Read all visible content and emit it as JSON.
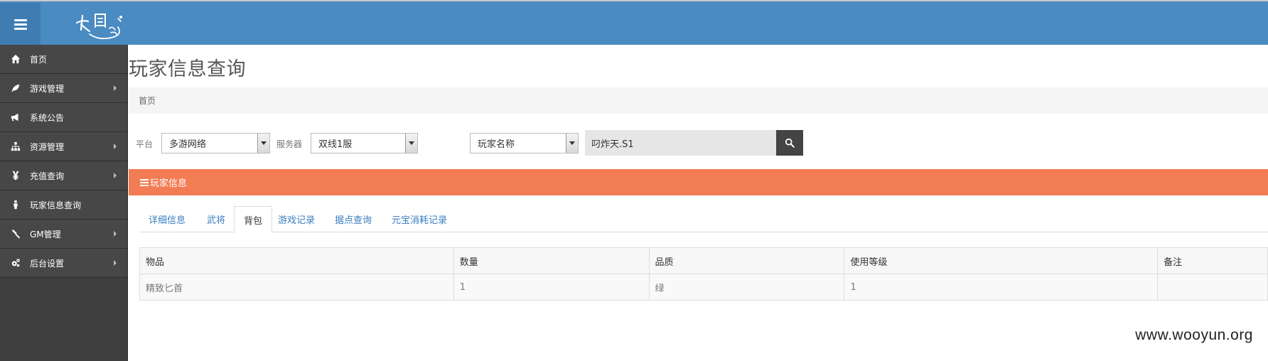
{
  "header": {
    "menu_toggle": "menu",
    "logo_icon": "calligraphy-logo-icon"
  },
  "sidebar": {
    "items": [
      {
        "label": "首页",
        "icon": "home-icon",
        "has_submenu": false
      },
      {
        "label": "游戏管理",
        "icon": "leaf-icon",
        "has_submenu": true
      },
      {
        "label": "系统公告",
        "icon": "bullhorn-icon",
        "has_submenu": false
      },
      {
        "label": "资源管理",
        "icon": "sitemap-icon",
        "has_submenu": true
      },
      {
        "label": "充值查询",
        "icon": "yen-icon",
        "has_submenu": true
      },
      {
        "label": "玩家信息查询",
        "icon": "user-icon",
        "has_submenu": false
      },
      {
        "label": "GM管理",
        "icon": "gavel-icon",
        "has_submenu": true
      },
      {
        "label": "后台设置",
        "icon": "gears-icon",
        "has_submenu": true
      }
    ]
  },
  "page": {
    "title": "玩家信息查询",
    "breadcrumb": "首页"
  },
  "filters": {
    "platform_label": "平台",
    "platform_value": "多游网络",
    "server_label": "服务器",
    "server_value": "双线1服",
    "query_type_value": "玩家名称",
    "search_value": "叼炸天.S1"
  },
  "panel": {
    "title": "玩家信息",
    "tabs": [
      {
        "label": "详细信息",
        "active": false
      },
      {
        "label": "武将",
        "active": false
      },
      {
        "label": "背包",
        "active": true
      },
      {
        "label": "游戏记录",
        "active": false
      },
      {
        "label": "据点查询",
        "active": false
      },
      {
        "label": "元宝消耗记录",
        "active": false
      }
    ]
  },
  "table": {
    "columns": [
      "物品",
      "数量",
      "品质",
      "使用等级",
      "备注"
    ],
    "rows": [
      [
        "精致匕首",
        "1",
        "绿",
        "1",
        ""
      ]
    ]
  },
  "watermark": "www.wooyun.org",
  "colors": {
    "topbar": "#4a8bc2",
    "sidebar": "#474747",
    "panel_header": "#f27c54",
    "link": "#3a7ebf"
  }
}
